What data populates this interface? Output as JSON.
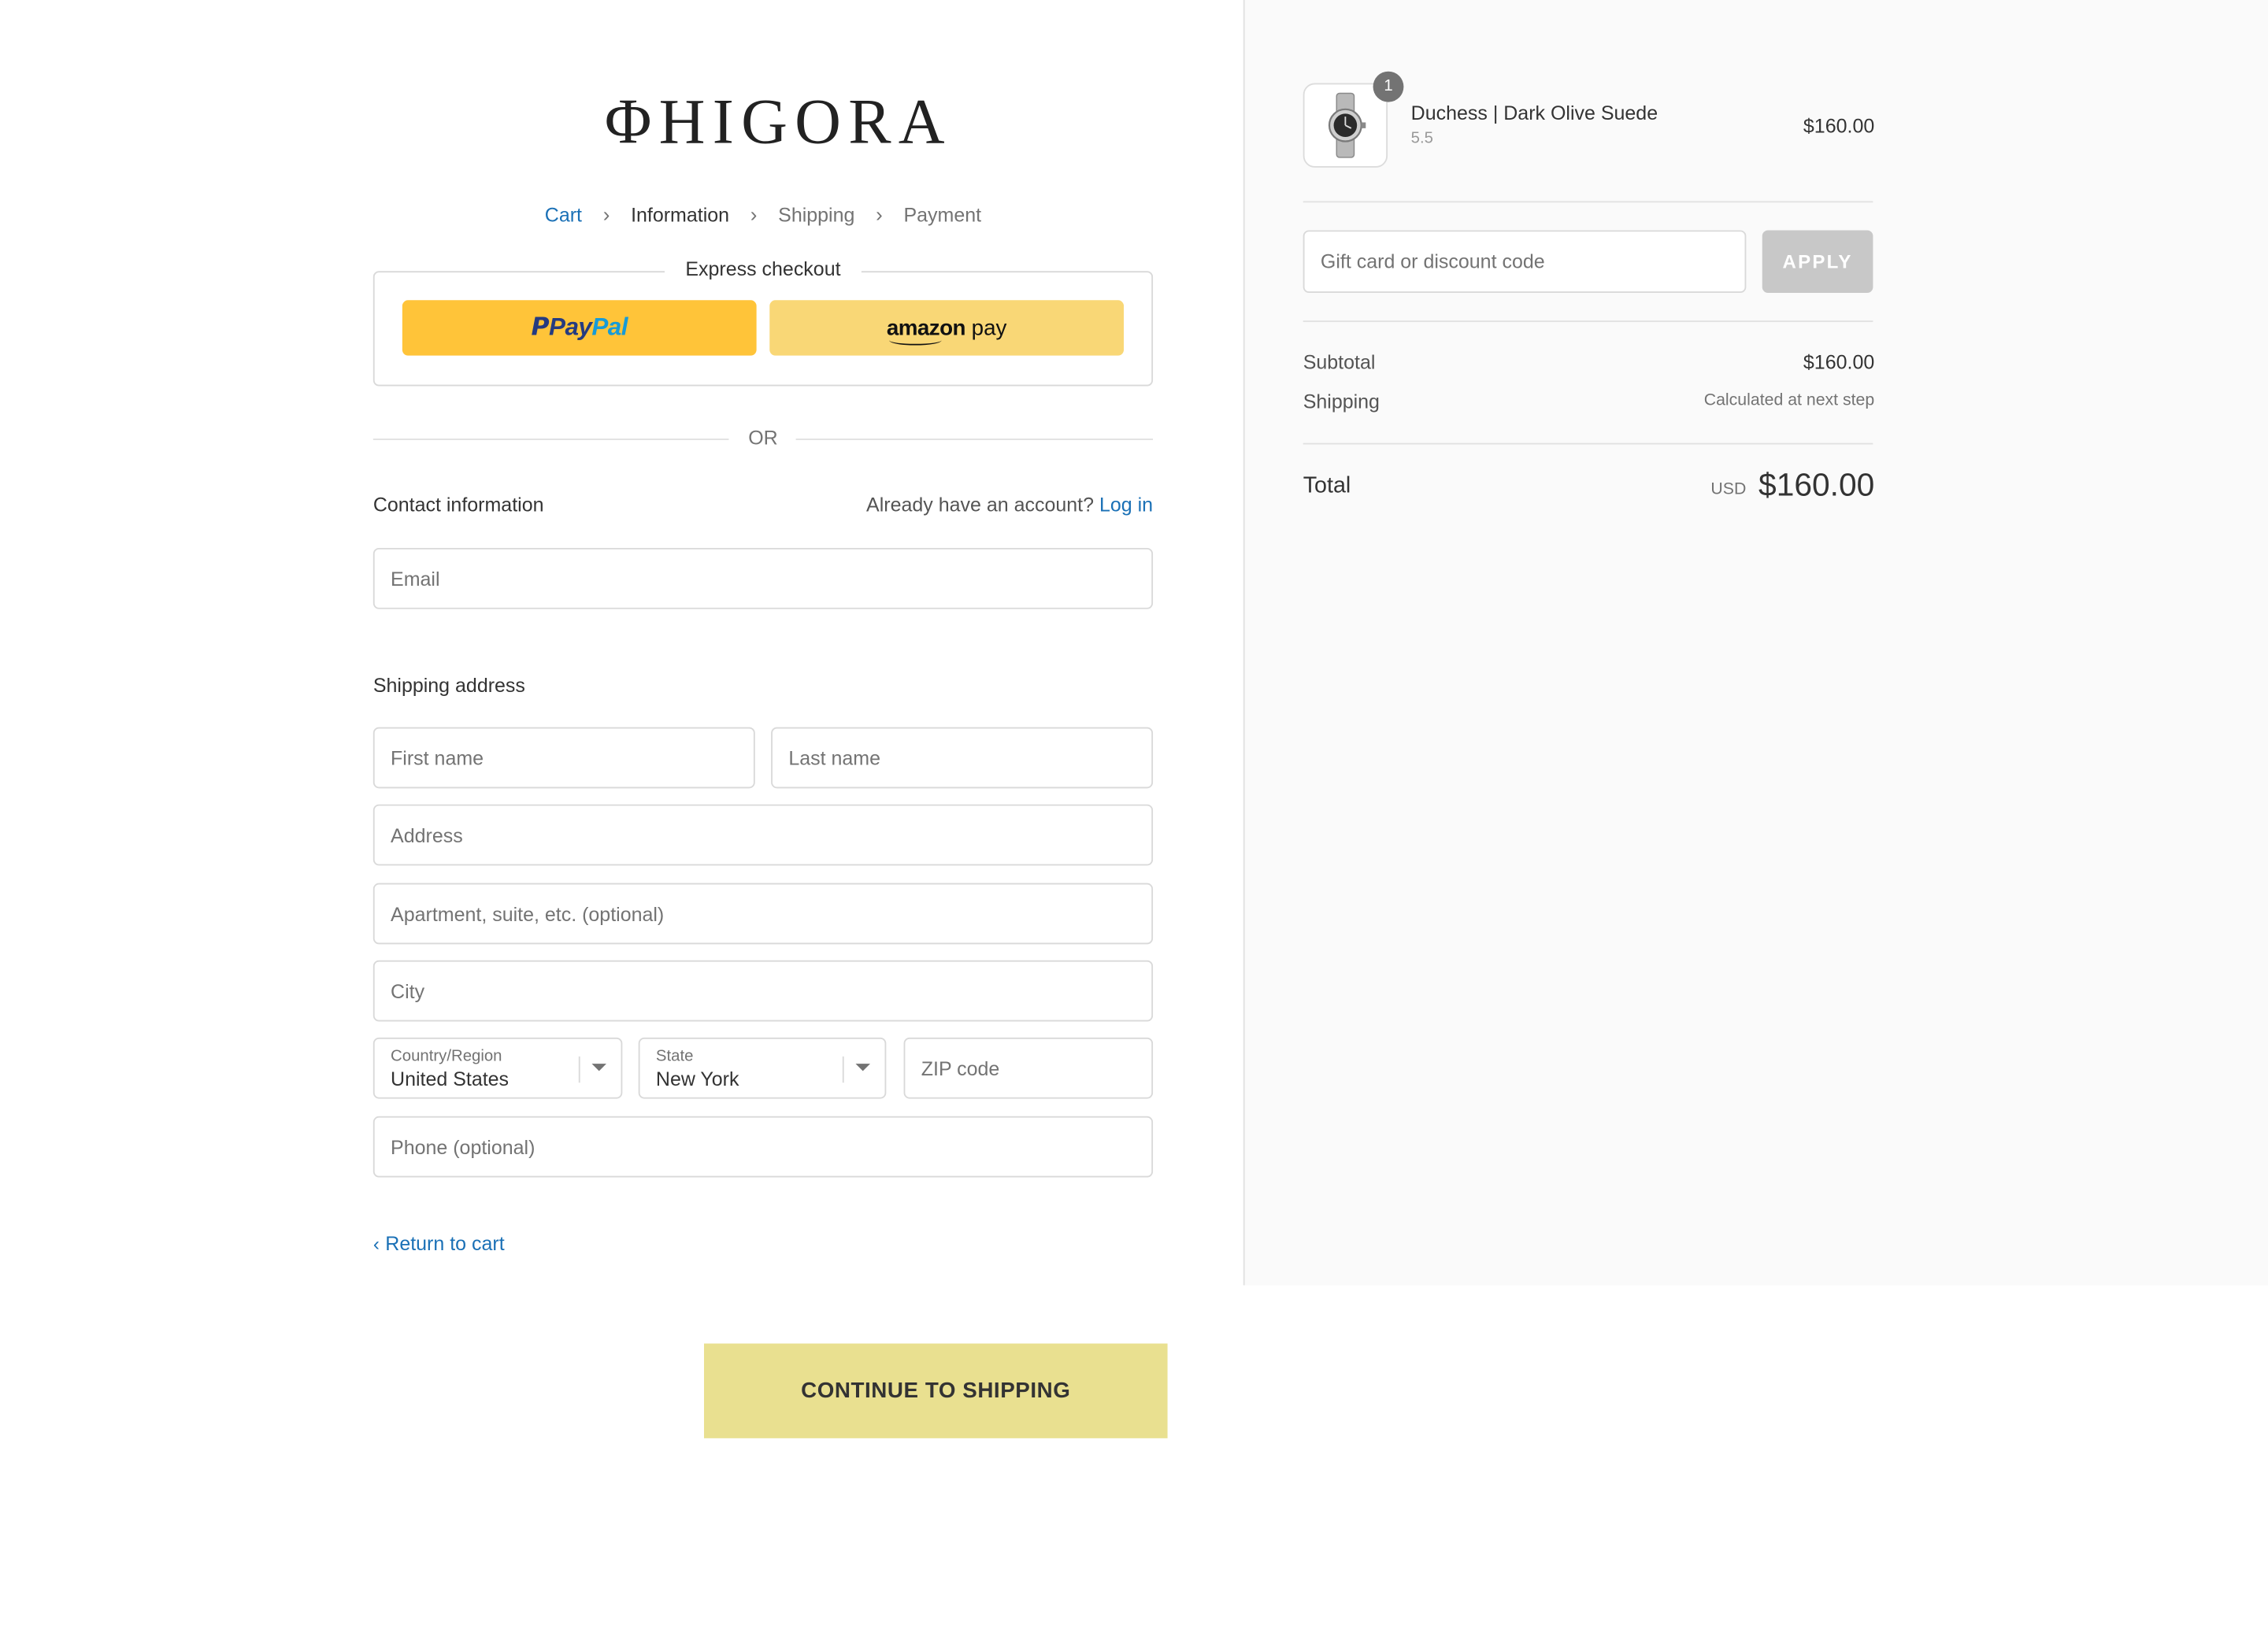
{
  "brand": {
    "logo_text": "ΦHIGORA"
  },
  "breadcrumb": {
    "items": [
      {
        "label": "Cart"
      },
      {
        "label": "Information"
      },
      {
        "label": "Shipping"
      },
      {
        "label": "Payment"
      }
    ]
  },
  "express_checkout": {
    "title": "Express checkout",
    "paypal_label": "PayPal",
    "paypal_part1": "Pay",
    "paypal_part2": "Pal",
    "amazon_label": "amazon pay",
    "amazon_part1": "amazon",
    "amazon_part2": "pay"
  },
  "divider_text": "OR",
  "contact": {
    "title": "Contact information",
    "account_prompt": "Already have an account?",
    "login_link": "Log in",
    "email_placeholder": "Email"
  },
  "shipping_address": {
    "title": "Shipping address",
    "first_name_placeholder": "First name",
    "last_name_placeholder": "Last name",
    "address_placeholder": "Address",
    "apartment_placeholder": "Apartment, suite, etc. (optional)",
    "city_placeholder": "City",
    "country_label": "Country/Region",
    "country_value": "United States",
    "state_label": "State",
    "state_value": "New York",
    "zip_placeholder": "ZIP code",
    "phone_placeholder": "Phone (optional)"
  },
  "actions": {
    "return_to_cart": "Return to cart",
    "continue": "CONTINUE TO SHIPPING"
  },
  "order_summary": {
    "product": {
      "quantity": "1",
      "name": "Duchess | Dark Olive Suede",
      "variant": "5.5",
      "price": "$160.00"
    },
    "discount_placeholder": "Gift card or discount code",
    "apply_label": "APPLY",
    "subtotal_label": "Subtotal",
    "subtotal_value": "$160.00",
    "shipping_label": "Shipping",
    "shipping_value": "Calculated at next step",
    "total_label": "Total",
    "currency": "USD",
    "total_value": "$160.00"
  },
  "colors": {
    "link": "#1a70b6",
    "paypal_yellow": "#ffc439",
    "amazon_yellow": "#f9d776",
    "continue_button": "#e9e090",
    "sidebar_bg": "#fafafa"
  }
}
